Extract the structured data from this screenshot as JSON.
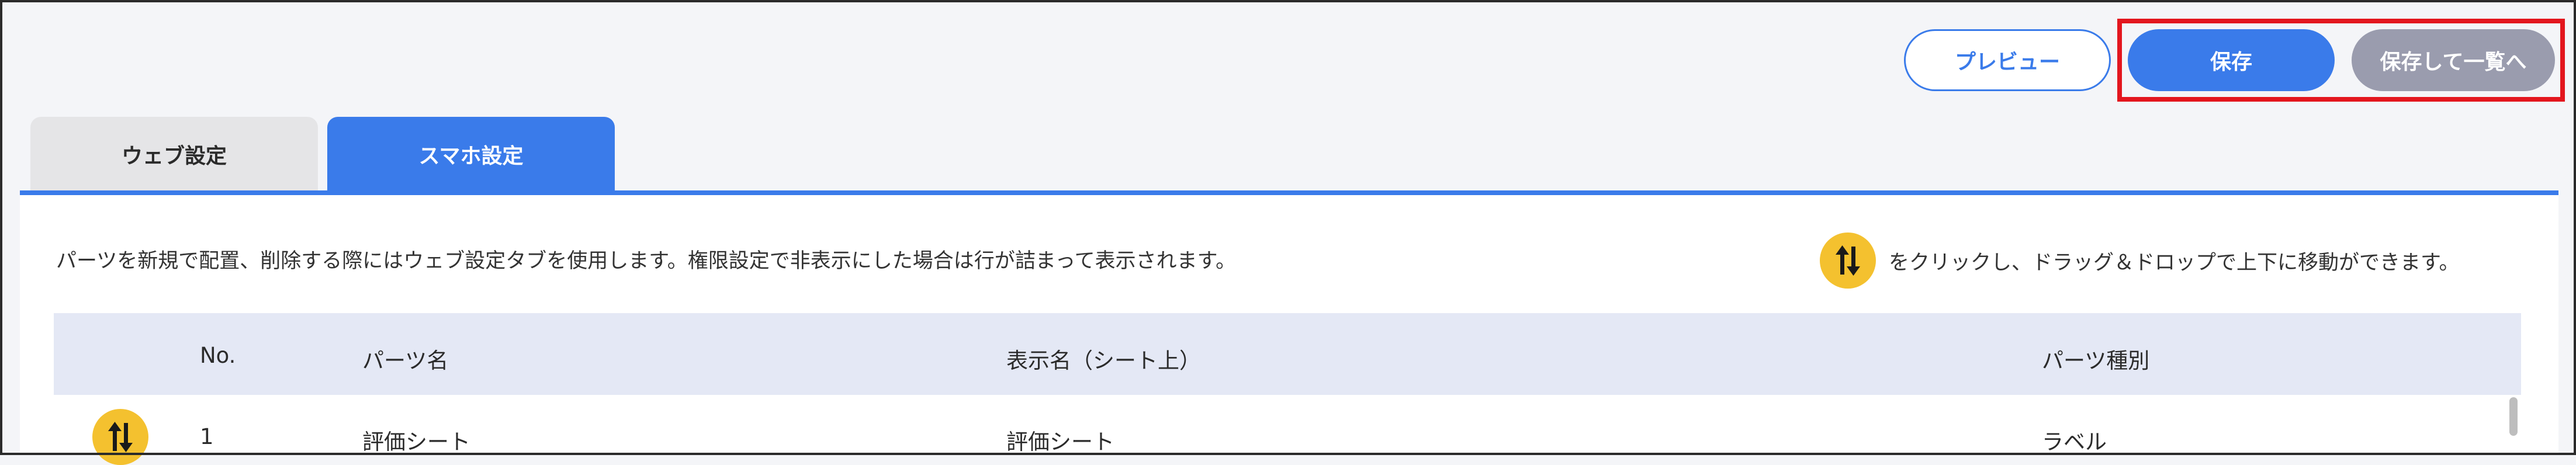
{
  "toolbar": {
    "preview_label": "プレビュー",
    "save_label": "保存",
    "save_list_label": "保存して一覧へ"
  },
  "tabs": [
    {
      "label": "ウェブ設定",
      "active": false
    },
    {
      "label": "スマホ設定",
      "active": true
    }
  ],
  "main": {
    "instruction": "パーツを新規で配置、削除する際にはウェブ設定タブを使用します。権限設定で非表示にした場合は行が詰まって表示されます。",
    "drag_hint": "をクリックし、ドラッグ＆ドロップで上下に移動ができます。",
    "drag_icon": "sort-arrows-icon"
  },
  "table": {
    "columns": [
      "No.",
      "パーツ名",
      "表示名（シート上）",
      "パーツ種別"
    ],
    "rows": [
      {
        "no": "1",
        "part_name": "評価シート",
        "display_name": "評価シート",
        "part_type": "ラベル"
      }
    ]
  },
  "colors": {
    "accent": "#3a7bea",
    "secondary_button": "#9a9cae",
    "drag_handle": "#f4c12f",
    "highlight": "#e3161e",
    "table_header_bg": "#e4e8f5"
  }
}
